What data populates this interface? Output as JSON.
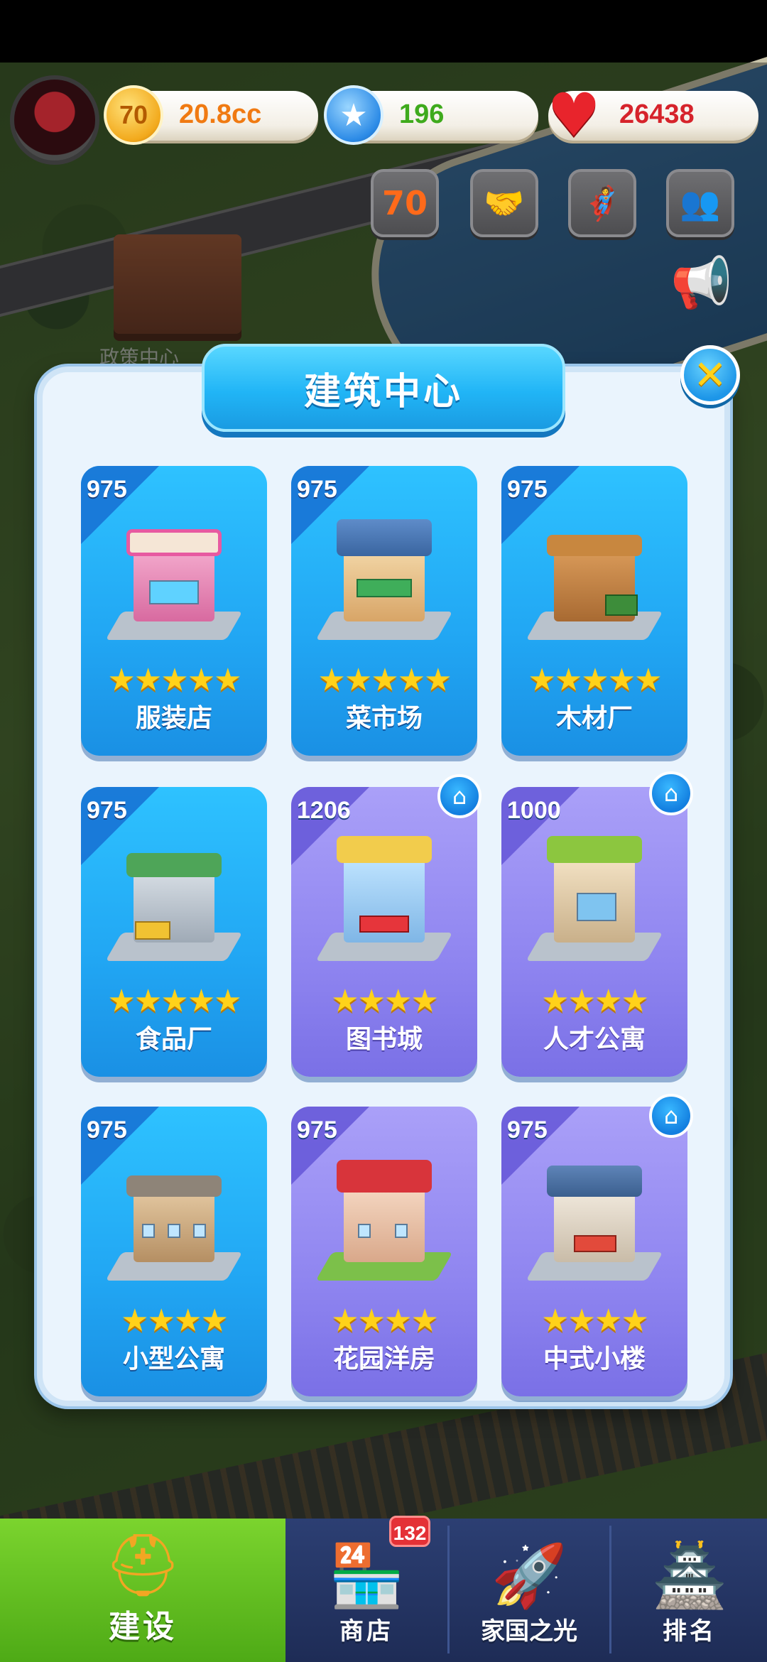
{
  "hud": {
    "coins": "20.8cc",
    "coin_icon_text": "70",
    "gems": "196",
    "hearts": "26438",
    "colors": {
      "coins": "#f07a12",
      "gems": "#3eaa1c",
      "hearts": "#d6232b"
    }
  },
  "top_buttons": [
    {
      "name": "event-70-icon",
      "text": "70"
    },
    {
      "name": "handshake-icon",
      "text": "🤝"
    },
    {
      "name": "hero-event-icon",
      "text": "🦸"
    },
    {
      "name": "friends-icon",
      "text": "👥"
    }
  ],
  "background": {
    "building_label": "政策中心"
  },
  "dialog": {
    "title": "建筑中心",
    "cards": [
      {
        "count": "975",
        "stars": "★★★★★",
        "name": "服装店",
        "theme": "blue",
        "owned_badge": false
      },
      {
        "count": "975",
        "stars": "★★★★★",
        "name": "菜市场",
        "theme": "blue",
        "owned_badge": false
      },
      {
        "count": "975",
        "stars": "★★★★★",
        "name": "木材厂",
        "theme": "blue",
        "owned_badge": false
      },
      {
        "count": "975",
        "stars": "★★★★★",
        "name": "食品厂",
        "theme": "blue",
        "owned_badge": false
      },
      {
        "count": "1206",
        "stars": "★★★★",
        "name": "图书城",
        "theme": "purple",
        "owned_badge": true
      },
      {
        "count": "1000",
        "stars": "★★★★",
        "name": "人才公寓",
        "theme": "purple",
        "owned_badge": true
      },
      {
        "count": "975",
        "stars": "★★★★",
        "name": "小型公寓",
        "theme": "blue",
        "owned_badge": false
      },
      {
        "count": "975",
        "stars": "★★★★",
        "name": "花园洋房",
        "theme": "purple",
        "owned_badge": false
      },
      {
        "count": "975",
        "stars": "★★★★",
        "name": "中式小楼",
        "theme": "purple",
        "owned_badge": true
      }
    ]
  },
  "nav": {
    "items": [
      {
        "label": "建设",
        "icon": "hard-hat-icon",
        "active": true
      },
      {
        "label": "商店",
        "icon": "shop-icon",
        "active": false
      },
      {
        "label": "家国之光",
        "icon": "rocket-icon",
        "active": false
      },
      {
        "label": "排名",
        "icon": "ranking-icon",
        "active": false
      }
    ],
    "shop_badge": "132"
  }
}
